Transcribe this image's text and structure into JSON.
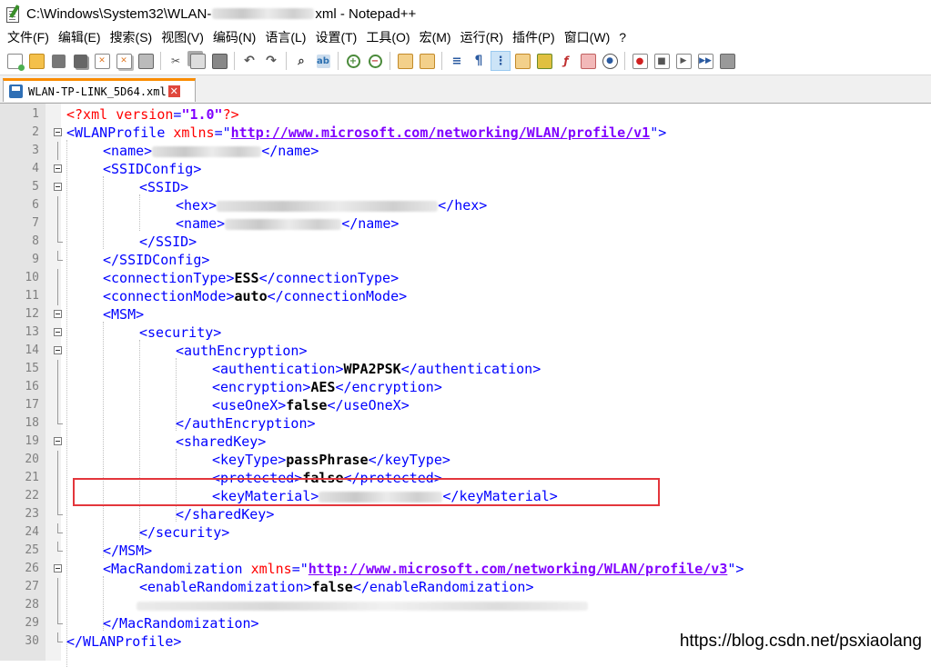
{
  "window": {
    "title_prefix": "C:\\Windows\\System32\\WLAN-",
    "title_suffix": "xml - Notepad++"
  },
  "menu": [
    "文件(F)",
    "编辑(E)",
    "搜索(S)",
    "视图(V)",
    "编码(N)",
    "语言(L)",
    "设置(T)",
    "工具(O)",
    "宏(M)",
    "运行(R)",
    "插件(P)",
    "窗口(W)",
    "?"
  ],
  "toolbar": {
    "buttons": [
      "new-file",
      "open-file",
      "save",
      "save-all",
      "close",
      "close-all",
      "print",
      "cut",
      "copy",
      "paste",
      "undo",
      "redo",
      "find",
      "replace",
      "zoom-in",
      "zoom-out",
      "sync-vertical",
      "sync-horizontal",
      "word-wrap",
      "show-all-chars",
      "indent-guide",
      "user-defined-language",
      "document-map",
      "function-list",
      "folder-workspace",
      "monitoring",
      "record-macro",
      "stop-recording",
      "play-macro",
      "run-macro-multiple",
      "save-macro"
    ]
  },
  "tab": {
    "label": "WLAN-TP-LINK_5D64.xml",
    "close_icon": "close-icon"
  },
  "editor": {
    "lines": [
      {
        "n": "1",
        "decl_open": "<?xml ",
        "decl_attr": "version",
        "decl_eq": "=",
        "decl_val": "\"1.0\"",
        "decl_close": "?>"
      },
      {
        "n": "2",
        "open": "<WLANProfile ",
        "attr": "xmlns",
        "eq": "=\"",
        "url": "http://www.microsoft.com/networking/WLAN/profile/v1",
        "close": "\">"
      },
      {
        "n": "3",
        "open": "<name>",
        "close": "</name>"
      },
      {
        "n": "4",
        "open": "<SSIDConfig>"
      },
      {
        "n": "5",
        "open": "<SSID>"
      },
      {
        "n": "6",
        "open": "<hex>",
        "close": "</hex>"
      },
      {
        "n": "7",
        "open": "<name>",
        "close": "</name>"
      },
      {
        "n": "8",
        "open": "</SSID>"
      },
      {
        "n": "9",
        "open": "</SSIDConfig>"
      },
      {
        "n": "10",
        "open": "<connectionType>",
        "text": "ESS",
        "close": "</connectionType>"
      },
      {
        "n": "11",
        "open": "<connectionMode>",
        "text": "auto",
        "close": "</connectionMode>"
      },
      {
        "n": "12",
        "open": "<MSM>"
      },
      {
        "n": "13",
        "open": "<security>"
      },
      {
        "n": "14",
        "open": "<authEncryption>"
      },
      {
        "n": "15",
        "open": "<authentication>",
        "text": "WPA2PSK",
        "close": "</authentication>"
      },
      {
        "n": "16",
        "open": "<encryption>",
        "text": "AES",
        "close": "</encryption>"
      },
      {
        "n": "17",
        "open": "<useOneX>",
        "text": "false",
        "close": "</useOneX>"
      },
      {
        "n": "18",
        "open": "</authEncryption>"
      },
      {
        "n": "19",
        "open": "<sharedKey>"
      },
      {
        "n": "20",
        "open": "<keyType>",
        "text": "passPhrase",
        "close": "</keyType>"
      },
      {
        "n": "21",
        "open": "<protected>",
        "text": "false",
        "close": "</protected>"
      },
      {
        "n": "22",
        "open": "<keyMaterial>",
        "close": "</keyMaterial>"
      },
      {
        "n": "23",
        "open": "</sharedKey>"
      },
      {
        "n": "24",
        "open": "</security>"
      },
      {
        "n": "25",
        "open": "</MSM>"
      },
      {
        "n": "26",
        "open": "<MacRandomization ",
        "attr": "xmlns",
        "eq": "=\"",
        "url": "http://www.microsoft.com/networking/WLAN/profile/v3",
        "close": "\">"
      },
      {
        "n": "27",
        "open": "<enableRandomization>",
        "text": "false",
        "close": "</enableRandomization>"
      },
      {
        "n": "28"
      },
      {
        "n": "29",
        "open": "</MacRandomization>"
      },
      {
        "n": "30",
        "open": "</WLANProfile>"
      }
    ]
  },
  "watermark": "https://blog.csdn.net/psxiaolang",
  "colors": {
    "tag": "#0000ff",
    "attribute": "#ff0000",
    "value": "#8000ff",
    "tab_accent": "#fa8c00",
    "highlight_box": "#e3363c"
  }
}
